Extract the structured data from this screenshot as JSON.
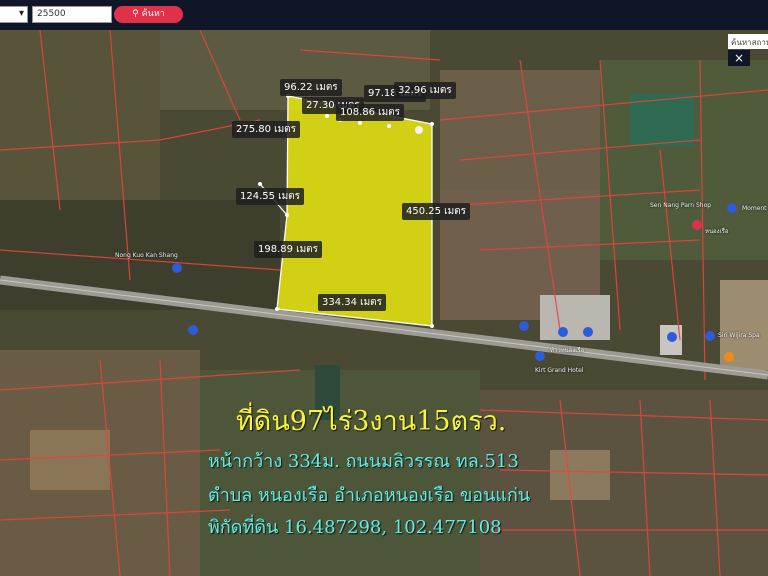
{
  "topbar": {
    "distance_value": "25500",
    "search_button_label": "ค้นหา",
    "search_icon": "search-icon",
    "select_icon": "chevron-down-icon"
  },
  "map_controls": {
    "search_placeholder": "ค้นหาสถาน",
    "close_label": "×"
  },
  "measurements": {
    "m1": "96.22 เมตร",
    "m2": "27.30 เมตร",
    "m3": "108.86 เมตร",
    "m4": "97.18 เมตร",
    "m5": "32.96 เมตร",
    "m6": "275.80 เมตร",
    "m7": "124.55 เมตร",
    "m8": "450.25 เมตร",
    "m9": "198.89 เมตร",
    "m10": "334.34 เมตร"
  },
  "pois": {
    "p1": "Nong Kuo Kan Shang",
    "p2": "Sen Nang Parn Shop",
    "p3": "Moment",
    "p4": "หนองเรือ",
    "p5": "Siri Wijira Spa",
    "p6": "ท้าวหนองเรือ",
    "p7": "Kirt Grand Hotel"
  },
  "caption": {
    "line1": "ที่ดิน97ไร่3งาน15ตรว.",
    "line2": "หน้ากว้าง 334ม. ถนนมลิวรรณ ทล.513",
    "line3": "ตำบล หนองเรือ อำเภอหนองเรือ ขอนแก่น",
    "line4": "พิกัดที่ดิน 16.487298, 102.477108"
  },
  "colors": {
    "parcel_fill": "#f2f20c",
    "parcel_border": "#ffffff",
    "boundary_lines": "#e8433b",
    "pin": "#2f5bd9",
    "road": "#9c9b94"
  }
}
